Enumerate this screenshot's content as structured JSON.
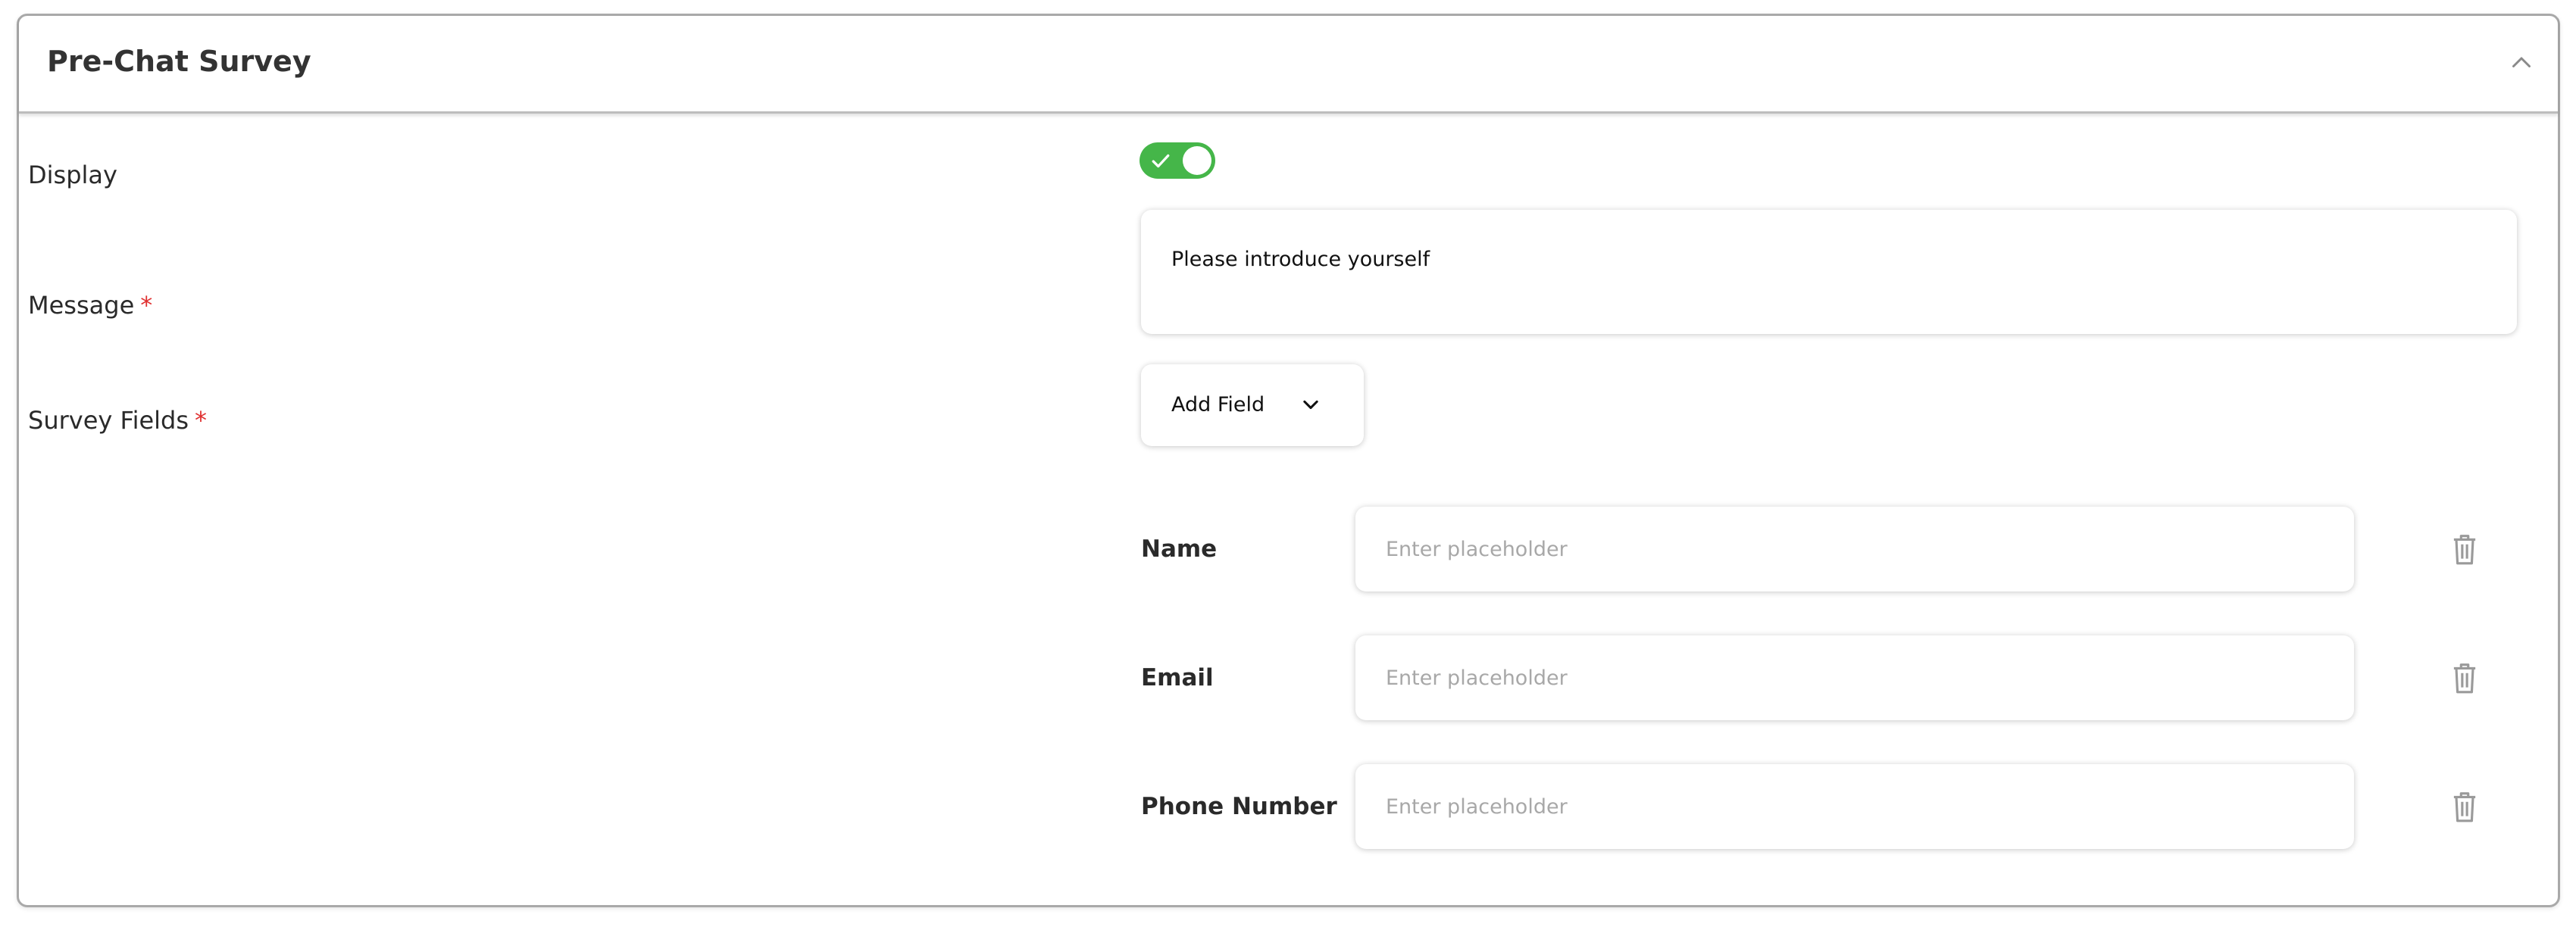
{
  "panel": {
    "title": "Pre-Chat Survey",
    "collapse_icon": "chevron-up-icon"
  },
  "display": {
    "label": "Display",
    "enabled": true,
    "toggle_color": "#45b649"
  },
  "message": {
    "label": "Message",
    "required_mark": "*",
    "value": "Please introduce yourself"
  },
  "survey_fields": {
    "label": "Survey Fields",
    "required_mark": "*",
    "add_field_button": "Add Field",
    "add_field_icon": "chevron-down-icon",
    "fields": [
      {
        "label": "Name",
        "placeholder": "Enter placeholder",
        "value": "",
        "delete_icon": "trash-icon"
      },
      {
        "label": "Email",
        "placeholder": "Enter placeholder",
        "value": "",
        "delete_icon": "trash-icon"
      },
      {
        "label": "Phone Number",
        "placeholder": "Enter placeholder",
        "value": "",
        "delete_icon": "trash-icon"
      }
    ]
  },
  "colors": {
    "required": "#e03131",
    "border": "#a9a9a9"
  }
}
